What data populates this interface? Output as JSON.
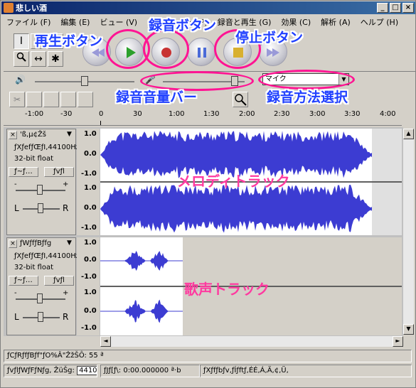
{
  "window": {
    "title": "悲しい酒",
    "min": "_",
    "max": "□",
    "close": "×"
  },
  "menu": [
    "ファイル (F)",
    "編集 (E)",
    "ビュー (V)",
    "プロジェクト (P)",
    "録音と再生 (G)",
    "効果 (C)",
    "解析 (A)",
    "ヘルプ (H)"
  ],
  "tools": {
    "select": "I",
    "envelope": "↕",
    "draw": "✎",
    "zoom": "🔍",
    "timeshift": "↔",
    "multi": "✱"
  },
  "annotations": {
    "play": "再生ボタン",
    "record": "録音ボタン",
    "stop": "停止ボタン",
    "rec_volume": "録音音量バー",
    "rec_method": "録音方法選択",
    "melody_track": "メロディトラック",
    "voice_track": "歌声トラック"
  },
  "mixer": {
    "input_select": "マイク"
  },
  "ruler": {
    "ticks": [
      "-1:00",
      "-30",
      "0",
      "30",
      "1:00",
      "1:30",
      "2:00",
      "2:30",
      "3:00",
      "3:30",
      "4:00"
    ]
  },
  "tracks": [
    {
      "name": "'ß,µ¢Žš",
      "info1": "ƒXƒefƒŒƒI,44100Hz",
      "info2": "32-bit float",
      "btn1": "ƒ~ƒ…",
      "btn2": "ƒvƒl",
      "gain_minus": "-",
      "gain_plus": "+",
      "pan_l": "L",
      "pan_r": "R",
      "scale": [
        "1.0",
        "0.0",
        "-1.0",
        "1.0",
        "0.0",
        "-1.0"
      ]
    },
    {
      "name": "ƒWƒfƒBƒfg",
      "info1": "ƒXƒefƒŒƒI,44100Hz",
      "info2": "32-bit float",
      "btn1": "ƒ~ƒ…",
      "btn2": "ƒvƒl",
      "gain_minus": "-",
      "gain_plus": "+",
      "pan_l": "L",
      "pan_r": "R",
      "scale": [
        "1.0",
        "0.0",
        "-1.0",
        "1.0",
        "0.0",
        "-1.0"
      ]
    }
  ],
  "status": {
    "line1": "ƒCƒRƒfƒBƒf\"ƒO%Â\"ŽžŠÔ: 55 ª",
    "rate_label": "ƒvƒlƒWƒFƒNƒg, ŽüŠg:",
    "rate_value": "44100",
    "cursor": "ƒJƒ[ƒ\\: 0:00.000000 ª·b",
    "snap": "ƒXƒfƒbƒv,ƒÍƒftƒ,ÉÉ,Á,Ä,¢,Ü,"
  },
  "colors": {
    "wave": "#3c3cd2",
    "annot_blue": "#2040ff",
    "annot_pink": "#ff3aa0",
    "ellipse": "#ff1493",
    "title_start": "#0a246a"
  }
}
